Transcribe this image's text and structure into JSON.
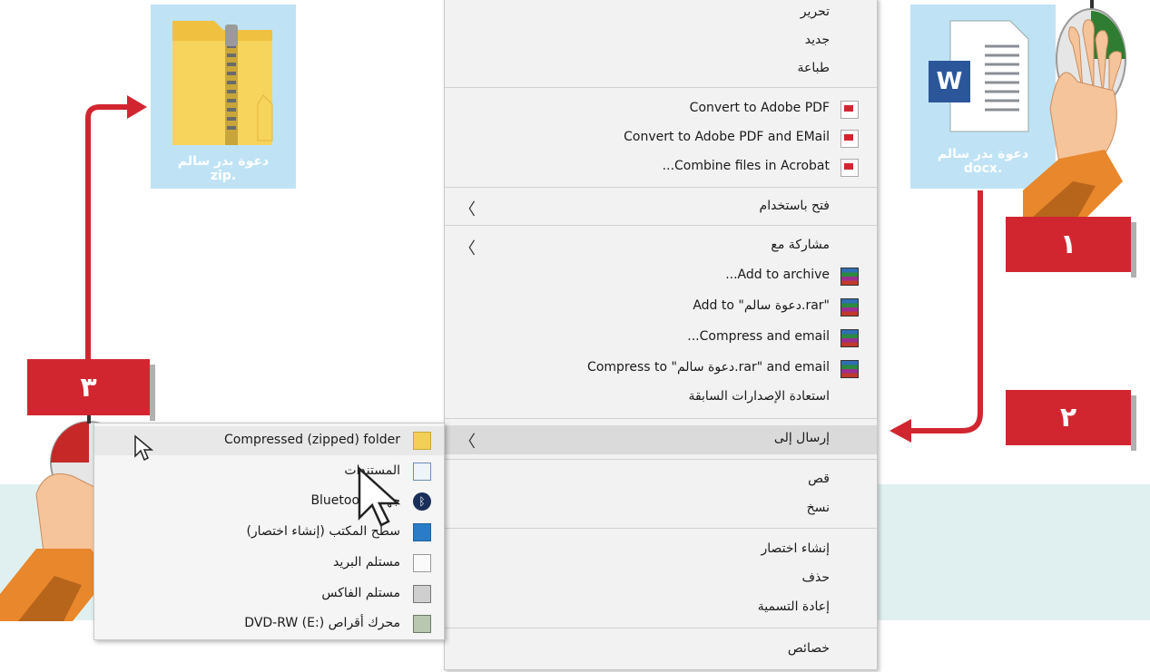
{
  "zip_file": {
    "name": "دعوة بدر سالم",
    "ext": "zip."
  },
  "docx_file": {
    "name": "دعوة بدر سالم",
    "ext": "docx.",
    "app_letter": "W"
  },
  "steps": {
    "one": "١",
    "two": "٢",
    "three": "٣"
  },
  "context_menu": {
    "top_items": [
      "تحرير",
      "جديد",
      "طباعة"
    ],
    "adobe_items": [
      "Convert to Adobe PDF",
      "Convert to Adobe PDF and EMail",
      "...Combine files in Acrobat"
    ],
    "open_with": "فتح باستخدام",
    "share_with": "مشاركة مع",
    "winrar_items": [
      "...Add to archive",
      "Add to \"دعوة سالم.rar\"",
      "...Compress and email",
      "Compress to \"دعوة سالم.rar\" and email"
    ],
    "restore_previous": "استعادة الإصدارات السابقة",
    "send_to": "إرسال إلى",
    "edit_items": [
      "قص",
      "نسخ"
    ],
    "manage_items": [
      "إنشاء اختصار",
      "حذف",
      "إعادة التسمية"
    ],
    "properties": "خصائص"
  },
  "send_to_menu": {
    "items": [
      {
        "label": "Compressed (zipped) folder",
        "icon": "zip-folder-icon"
      },
      {
        "label": "المستندات",
        "icon": "documents-icon"
      },
      {
        "label": "Bluetooth جهاز",
        "icon": "bluetooth-icon"
      },
      {
        "label": "سطح المكتب (إنشاء اختصار)",
        "icon": "desktop-icon"
      },
      {
        "label": "مستلم البريد",
        "icon": "mail-icon"
      },
      {
        "label": "مستلم الفاكس",
        "icon": "fax-icon"
      },
      {
        "label": "محرك أقراص DVD-RW (E:)",
        "icon": "dvd-drive-icon"
      }
    ]
  },
  "colors": {
    "accent_red": "#d12630",
    "tile_blue": "#bfe3f5",
    "band_teal": "#e0f0f0",
    "skin": "#f6c49a",
    "sleeve_orange": "#e8872b"
  }
}
